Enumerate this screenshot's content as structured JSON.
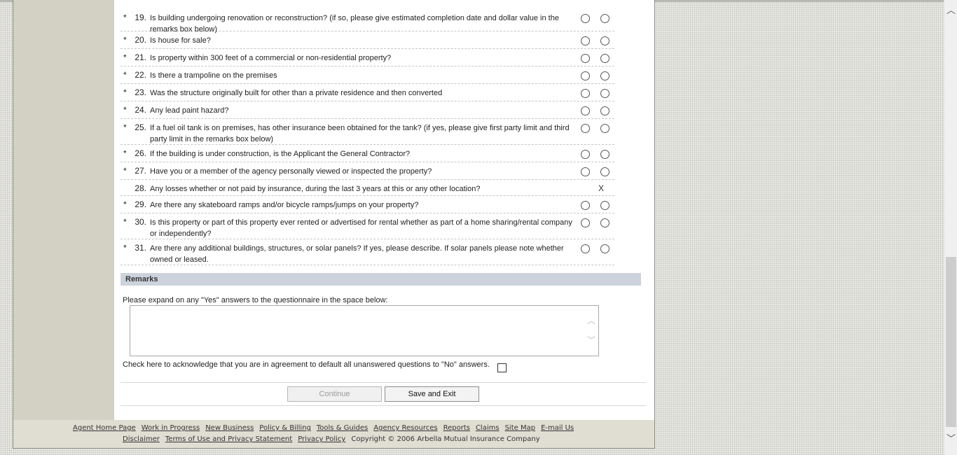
{
  "questions": [
    {
      "num": "19.",
      "required": true,
      "text": "Is building undergoing renovation or reconstruction? (if so, please give estimated completion date and dollar value in the remarks box below)",
      "answer_display": "radio"
    },
    {
      "num": "20.",
      "required": true,
      "text": "Is house for sale?",
      "answer_display": "radio"
    },
    {
      "num": "21.",
      "required": true,
      "text": "Is property within 300 feet of a commercial or non-residential property?",
      "answer_display": "radio"
    },
    {
      "num": "22.",
      "required": true,
      "text": "Is there a trampoline on the premises",
      "answer_display": "radio"
    },
    {
      "num": "23.",
      "required": true,
      "text": "Was the structure originally built for other than a private residence and then converted",
      "answer_display": "radio"
    },
    {
      "num": "24.",
      "required": true,
      "text": "Any lead paint hazard?",
      "answer_display": "radio"
    },
    {
      "num": "25.",
      "required": true,
      "text": "If a fuel oil tank is on premises, has other insurance been obtained for the tank? (if yes, please give first party limit and third party limit in the remarks box below)",
      "answer_display": "radio"
    },
    {
      "num": "26.",
      "required": true,
      "text": "If the building is under construction, is the Applicant the General Contractor?",
      "answer_display": "radio"
    },
    {
      "num": "27.",
      "required": true,
      "text": "Have you or a member of the agency personally viewed or inspected the property?",
      "answer_display": "radio"
    },
    {
      "num": "28.",
      "required": false,
      "text": "Any losses whether or not paid by insurance, during the last 3 years at this or any other location?",
      "answer_display": "X"
    },
    {
      "num": "29.",
      "required": true,
      "text": "Are there any skateboard ramps and/or bicycle ramps/jumps on your property?",
      "answer_display": "radio"
    },
    {
      "num": "30.",
      "required": true,
      "text": "Is this property or part of this property ever rented or advertised for rental whether as part of a home sharing/rental company or independently?",
      "answer_display": "radio"
    },
    {
      "num": "31.",
      "required": true,
      "text": "Are there any additional buildings, structures, or solar panels? If yes, please describe. If solar panels please note whether owned or leased.",
      "answer_display": "radio"
    }
  ],
  "required_marker": "*",
  "remarks": {
    "header": "Remarks",
    "prompt": "Please expand on any \"Yes\" answers to the questionnaire in the space below:",
    "value": ""
  },
  "acknowledge": {
    "label": "Check here to acknowledge that you are in agreement to default all unanswered questions to \"No\" answers.",
    "checked": false
  },
  "buttons": {
    "continue": "Continue",
    "save_exit": "Save and Exit"
  },
  "footer": {
    "links_row1": [
      "Agent Home Page",
      "Work in Progress",
      "New Business",
      "Policy & Billing",
      "Tools & Guides",
      "Agency Resources",
      "Reports",
      "Claims",
      "Site Map",
      "E-mail Us"
    ],
    "links_row2": [
      "Disclaimer",
      "Terms of Use and Privacy Statement",
      "Privacy Policy"
    ],
    "copyright": "Copyright © 2006 Arbella Mutual Insurance Company"
  },
  "icons": {
    "scroll_up": "chevron-up-icon",
    "scroll_down": "chevron-down-icon"
  }
}
